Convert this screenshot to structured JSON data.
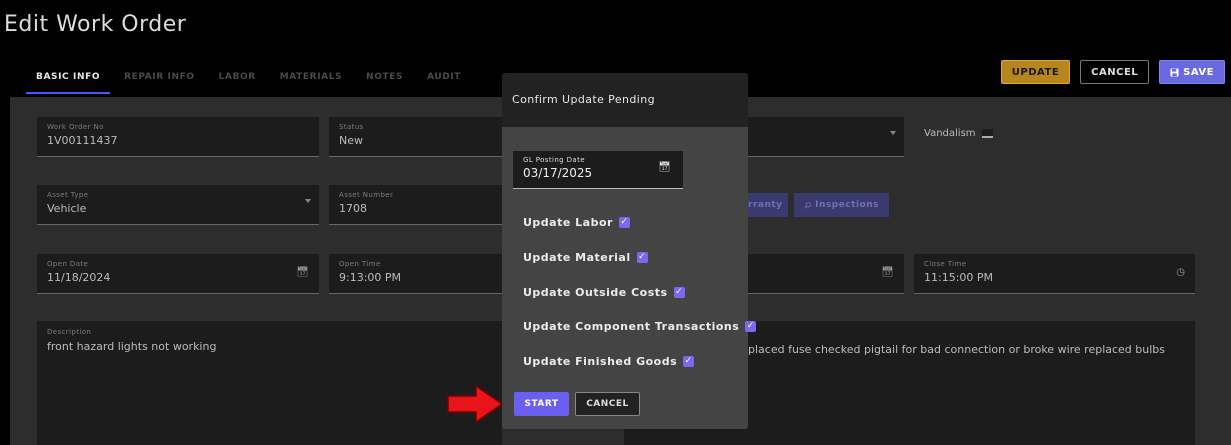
{
  "page": {
    "title": "Edit Work Order"
  },
  "tabs": [
    {
      "label": "BASIC INFO",
      "active": true
    },
    {
      "label": "REPAIR INFO",
      "active": false
    },
    {
      "label": "LABOR",
      "active": false
    },
    {
      "label": "MATERIALS",
      "active": false
    },
    {
      "label": "NOTES",
      "active": false
    },
    {
      "label": "AUDIT",
      "active": false
    }
  ],
  "toolbar": {
    "update_label": "UPDATE",
    "cancel_label": "CANCEL",
    "save_label": "SAVE"
  },
  "form": {
    "work_order_no": {
      "label": "Work Order No",
      "value": "1V00111437"
    },
    "status": {
      "label": "Status",
      "value": "New"
    },
    "vandalism_label": "Vandalism",
    "asset_type": {
      "label": "Asset Type",
      "value": "Vehicle"
    },
    "asset_number": {
      "label": "Asset Number",
      "value": "1708"
    },
    "warranty_label": "rranty",
    "inspections_label": "Inspections",
    "open_date": {
      "label": "Open Date",
      "value": "11/18/2024"
    },
    "open_time": {
      "label": "Open Time",
      "value": "9:13:00 PM"
    },
    "close_time": {
      "label": "Close Time",
      "value": "11:15:00 PM"
    },
    "description": {
      "label": "Description",
      "value": "front hazard lights not working"
    },
    "repair_text": "placed fuse checked pigtail for bad connection or broke wire replaced bulbs"
  },
  "modal": {
    "title": "Confirm Update Pending",
    "gl_posting_date": {
      "label": "GL Posting Date",
      "value": "03/17/2025"
    },
    "options": [
      {
        "label": "Update Labor",
        "checked": true
      },
      {
        "label": "Update Material",
        "checked": true
      },
      {
        "label": "Update Outside Costs",
        "checked": true
      },
      {
        "label": "Update Component Transactions",
        "checked": true
      },
      {
        "label": "Update Finished Goods",
        "checked": true
      }
    ],
    "start_label": "START",
    "cancel_label": "CANCEL"
  },
  "icons": {
    "calendar": "calendar-icon",
    "clock": "clock-icon",
    "save": "floppy-disk-icon",
    "search": "magnifier-icon",
    "arrow": "red-arrow-icon"
  },
  "colors": {
    "update_button": "#b7861c",
    "save_button": "#6a6ae0",
    "start_button": "#6a5ff0",
    "checkbox": "#7b68ee",
    "active_tab_underline": "#3d5afe",
    "arrow": "#e8141a"
  }
}
